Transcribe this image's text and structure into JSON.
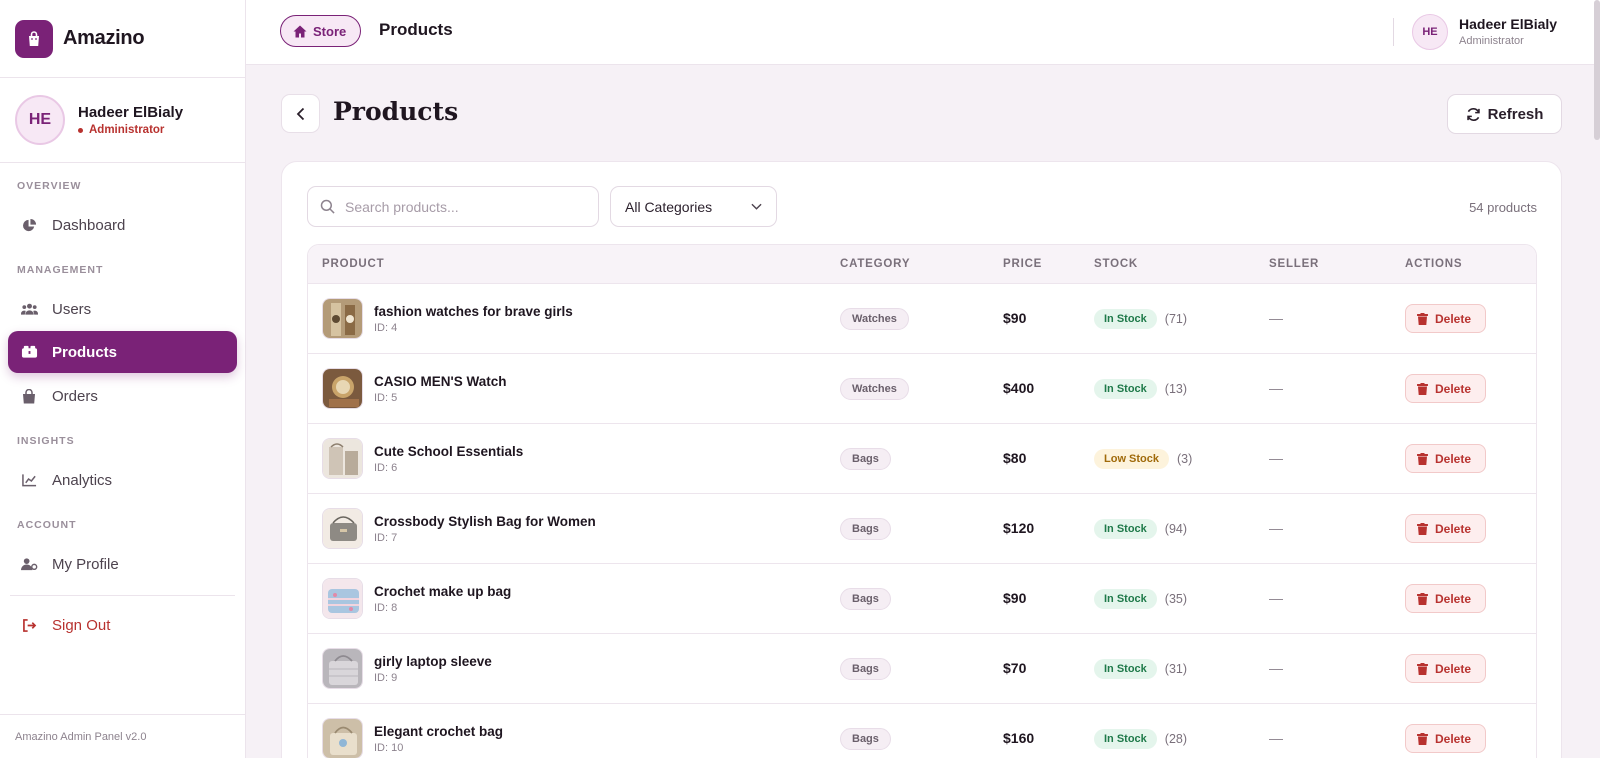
{
  "brand": {
    "name": "Amazino"
  },
  "sidebar_profile": {
    "initials": "HE",
    "name": "Hadeer ElBialy",
    "role": "Administrator"
  },
  "nav": {
    "overview": "OVERVIEW",
    "dashboard": "Dashboard",
    "management": "MANAGEMENT",
    "users": "Users",
    "products": "Products",
    "orders": "Orders",
    "insights": "INSIGHTS",
    "analytics": "Analytics",
    "account": "ACCOUNT",
    "my_profile": "My Profile",
    "sign_out": "Sign Out"
  },
  "footer": "Amazino Admin Panel v2.0",
  "topbar": {
    "store_label": "Store",
    "title": "Products",
    "user_initials": "HE",
    "user_name": "Hadeer ElBialy",
    "user_role": "Administrator"
  },
  "page": {
    "title": "Products",
    "refresh_label": "Refresh"
  },
  "filters": {
    "search_placeholder": "Search products...",
    "category_selected": "All Categories",
    "count_text": "54 products"
  },
  "table": {
    "headers": {
      "product": "PRODUCT",
      "category": "CATEGORY",
      "price": "PRICE",
      "stock": "STOCK",
      "seller": "SELLER",
      "actions": "ACTIONS"
    },
    "delete_label": "Delete",
    "rows": [
      {
        "name": "fashion watches for brave girls",
        "id": "ID: 4",
        "category": "Watches",
        "price": "$90",
        "stock": "In Stock",
        "qty": "(71)",
        "seller": "—"
      },
      {
        "name": "CASIO MEN'S Watch",
        "id": "ID: 5",
        "category": "Watches",
        "price": "$400",
        "stock": "In Stock",
        "qty": "(13)",
        "seller": "—"
      },
      {
        "name": "Cute School Essentials",
        "id": "ID: 6",
        "category": "Bags",
        "price": "$80",
        "stock": "Low Stock",
        "qty": "(3)",
        "seller": "—"
      },
      {
        "name": "Crossbody Stylish Bag for Women",
        "id": "ID: 7",
        "category": "Bags",
        "price": "$120",
        "stock": "In Stock",
        "qty": "(94)",
        "seller": "—"
      },
      {
        "name": "Crochet make up bag",
        "id": "ID: 8",
        "category": "Bags",
        "price": "$90",
        "stock": "In Stock",
        "qty": "(35)",
        "seller": "—"
      },
      {
        "name": "girly laptop sleeve",
        "id": "ID: 9",
        "category": "Bags",
        "price": "$70",
        "stock": "In Stock",
        "qty": "(31)",
        "seller": "—"
      },
      {
        "name": "Elegant crochet bag",
        "id": "ID: 10",
        "category": "Bags",
        "price": "$160",
        "stock": "In Stock",
        "qty": "(28)",
        "seller": "—"
      }
    ]
  },
  "colors": {
    "accent": "#7a2277",
    "danger": "#b8322f",
    "success": "#1f7a4a",
    "warning": "#a06a0a"
  }
}
